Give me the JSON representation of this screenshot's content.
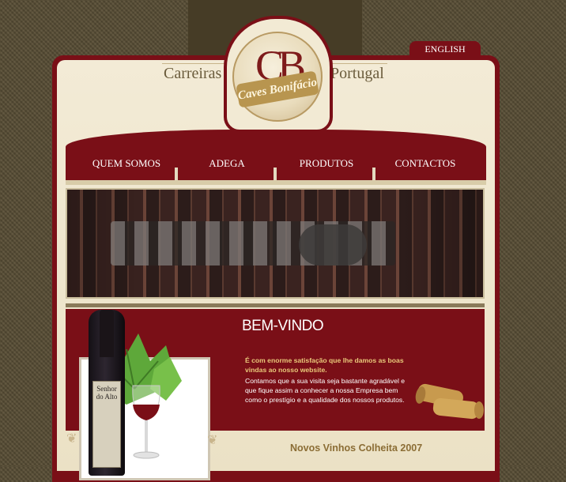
{
  "header": {
    "brand_left": "Carreiras",
    "brand_right": "Portugal",
    "logo_letters": "CB",
    "logo_ribbon": "Caves Bonifácio",
    "language_link": "ENGLISH"
  },
  "nav": {
    "items": [
      {
        "label": "QUEM SOMOS"
      },
      {
        "label": "ADEGA"
      },
      {
        "label": "PRODUTOS"
      },
      {
        "label": "CONTACTOS"
      }
    ]
  },
  "welcome": {
    "title": "BEM-VINDO",
    "lead": "É com enorme satisfação que lhe damos as boas vindas ao nosso website.",
    "body": "Contamos que a sua visita seja bastante agradável e que fique assim a conhecer a nossa Empresa bem como o prestígio e a qualidade dos nossos produtos.",
    "bottle_label": "Senhor do Alto"
  },
  "footer": {
    "news_title": "Novos Vinhos Colheita 2007"
  },
  "colors": {
    "wine_red": "#7a0f17",
    "cream": "#f3ebd6",
    "gold": "#e9c87a",
    "background": "#5b5037"
  }
}
